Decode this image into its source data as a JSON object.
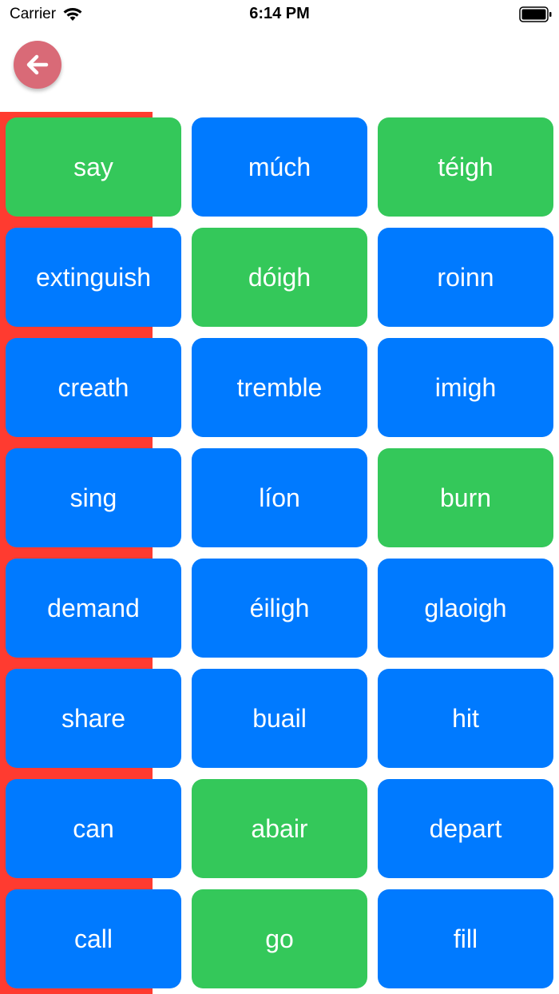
{
  "status_bar": {
    "carrier": "Carrier",
    "time": "6:14 PM"
  },
  "nav": {
    "back_icon": "arrow-left-icon",
    "back_color": "#d96a77"
  },
  "colors": {
    "blue": "#007aff",
    "green": "#34c85a",
    "red": "#ff3b30"
  },
  "tiles": [
    {
      "label": "say",
      "color": "green"
    },
    {
      "label": "múch",
      "color": "blue"
    },
    {
      "label": "téigh",
      "color": "green"
    },
    {
      "label": "extinguish",
      "color": "blue"
    },
    {
      "label": "dóigh",
      "color": "green"
    },
    {
      "label": "roinn",
      "color": "blue"
    },
    {
      "label": "creath",
      "color": "blue"
    },
    {
      "label": "tremble",
      "color": "blue"
    },
    {
      "label": "imigh",
      "color": "blue"
    },
    {
      "label": "sing",
      "color": "blue"
    },
    {
      "label": "líon",
      "color": "blue"
    },
    {
      "label": "burn",
      "color": "green"
    },
    {
      "label": "demand",
      "color": "blue"
    },
    {
      "label": "éiligh",
      "color": "blue"
    },
    {
      "label": "glaoigh",
      "color": "blue"
    },
    {
      "label": "share",
      "color": "blue"
    },
    {
      "label": "buail",
      "color": "blue"
    },
    {
      "label": "hit",
      "color": "blue"
    },
    {
      "label": "can",
      "color": "blue"
    },
    {
      "label": "abair",
      "color": "green"
    },
    {
      "label": "depart",
      "color": "blue"
    },
    {
      "label": "call",
      "color": "blue"
    },
    {
      "label": "go",
      "color": "green"
    },
    {
      "label": "fill",
      "color": "blue"
    }
  ]
}
